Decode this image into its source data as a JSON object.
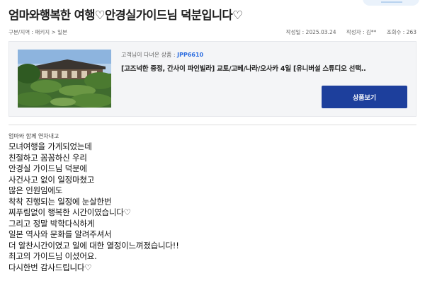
{
  "review": {
    "title": "엄마와행복한 여행♡안경실가이드님 덕분입니다♡",
    "breadcrumb": "구분/지역 : 패키지 > 일본",
    "date": "작성일 : 2025.03.24",
    "author": "작성자 : 김**",
    "views": "조회수 : 263"
  },
  "product": {
    "visited_prefix": "고객님이 다녀온 상품 :",
    "code": "JPP6610",
    "name": "[고즈넉한 중정, 간사이 파인빌라] 교토/고베/나라/오사카 4일 [유니버설 스튜디오 선택..",
    "button_label": "상품보기"
  },
  "content": {
    "subtitle": "엄마와 함께 연차내고",
    "lines": [
      "모녀여행을 가게되었는데",
      "친절하고 꼼꼼하신 우리",
      "안경실 가이드님 덕분에",
      "사건사고 없이 일정마쳤고",
      "많은 인원임에도",
      "착착 진행되는 일정에 눈살한번",
      "찌푸림없이 행복한 시간이였습니다♡",
      "그리고 정말 박학다식하게",
      "일본 역사와 문화를 알려주셔서",
      "더 알찬시간이였고 일에 대한 열정이느껴졌습니다!!",
      "최고의 가이드님 이셨어요.",
      "다시한번 감사드립니다♡"
    ]
  },
  "colors": {
    "accent": "#2f6fe0",
    "button": "#1d3f9c"
  }
}
